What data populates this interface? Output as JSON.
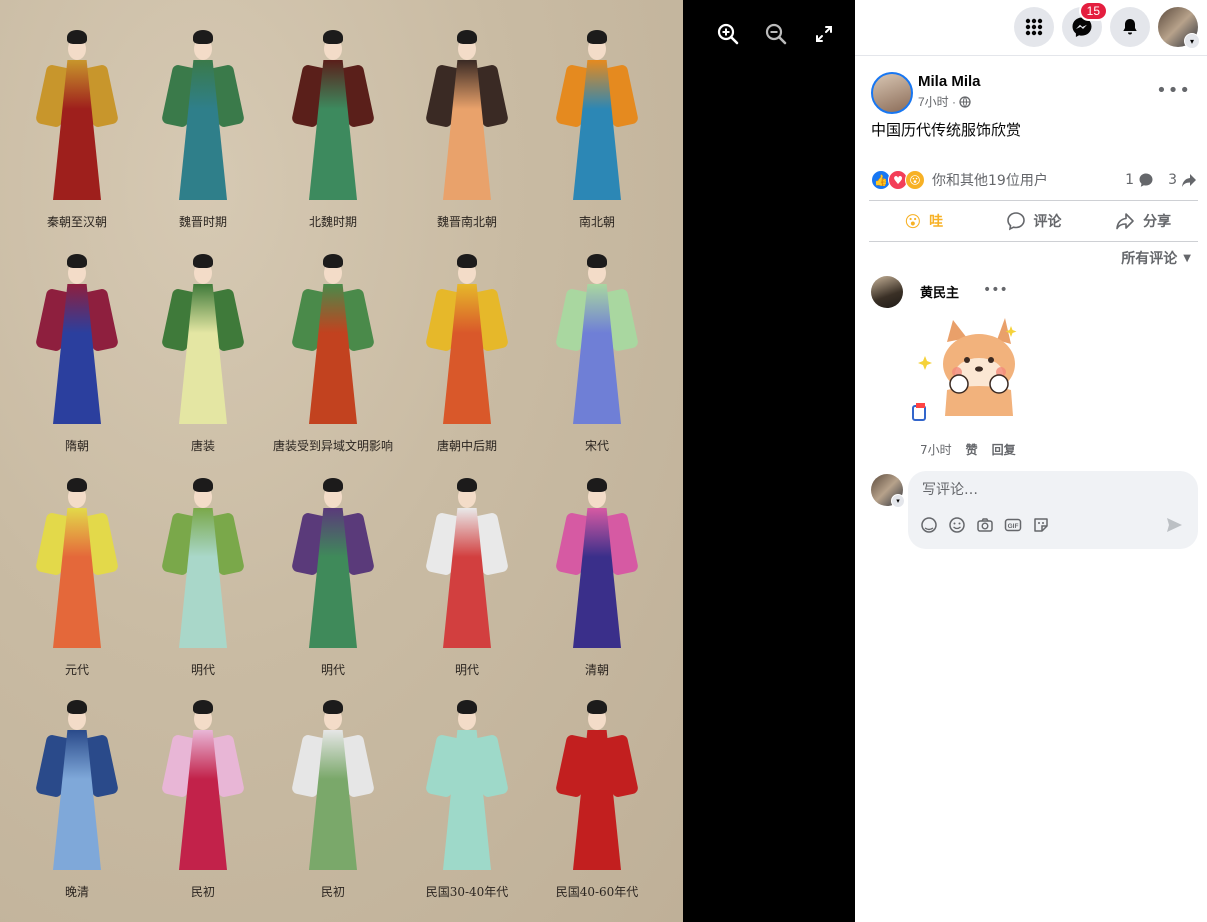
{
  "viewer": {
    "costumes": [
      {
        "label": "秦朝至汉朝",
        "colors": [
          "#9e1f1c",
          "#c8962c"
        ]
      },
      {
        "label": "魏晋时期",
        "colors": [
          "#2f7f8a",
          "#3a7a4a"
        ]
      },
      {
        "label": "北魏时期",
        "colors": [
          "#3d8a5e",
          "#5a1f1a"
        ]
      },
      {
        "label": "魏晋南北朝",
        "colors": [
          "#e9a26b",
          "#3a2a24"
        ]
      },
      {
        "label": "南北朝",
        "colors": [
          "#2c87b5",
          "#e58a1f"
        ]
      },
      {
        "label": "隋朝",
        "colors": [
          "#2b3f9e",
          "#8e1f3e"
        ]
      },
      {
        "label": "唐装",
        "colors": [
          "#e4e6a3",
          "#3f7a3a"
        ]
      },
      {
        "label": "唐装受到异域文明影响",
        "colors": [
          "#c2421f",
          "#4a8a4a"
        ]
      },
      {
        "label": "唐朝中后期",
        "colors": [
          "#d9582a",
          "#e6b82a"
        ]
      },
      {
        "label": "宋代",
        "colors": [
          "#6f7fd6",
          "#a9d7a0"
        ]
      },
      {
        "label": "元代",
        "colors": [
          "#e4683a",
          "#e3d94a"
        ]
      },
      {
        "label": "明代",
        "colors": [
          "#a9d7c9",
          "#7aa84a"
        ]
      },
      {
        "label": "明代",
        "colors": [
          "#3f8a5a",
          "#5a3a7a"
        ]
      },
      {
        "label": "明代",
        "colors": [
          "#d23f3f",
          "#e9e9e9"
        ]
      },
      {
        "label": "清朝",
        "colors": [
          "#3a2f8a",
          "#d65aa3"
        ]
      },
      {
        "label": "晚清",
        "colors": [
          "#7fa8d9",
          "#2a4a8a"
        ]
      },
      {
        "label": "民初",
        "colors": [
          "#c2224a",
          "#e8b6d6"
        ]
      },
      {
        "label": "民初",
        "colors": [
          "#7aa86a",
          "#e6e6e6"
        ]
      },
      {
        "label": "民国30-40年代",
        "colors": [
          "#9ed9c9",
          "#9ed9c9"
        ]
      },
      {
        "label": "民国40-60年代",
        "colors": [
          "#c21f1f",
          "#c21f1f"
        ]
      }
    ],
    "zoom_in_icon": "zoom-in-icon",
    "zoom_out_icon": "zoom-out-icon",
    "fullscreen_icon": "fullscreen-icon"
  },
  "topbar": {
    "messenger_badge": "15"
  },
  "post": {
    "author": "Mila Mila",
    "time": "7小时 ·",
    "text": "中国历代传统服饰欣赏",
    "reaction_summary": "你和其他19位用户",
    "comment_count": "1",
    "share_count": "3",
    "actions": {
      "react": "哇",
      "comment": "评论",
      "share": "分享"
    },
    "sort_label": "所有评论"
  },
  "comment": {
    "author": "黄民主",
    "time": "7小时",
    "like": "赞",
    "reply": "回复"
  },
  "composer": {
    "placeholder": "写评论…"
  },
  "colors": {
    "accent": "#1877f2",
    "wow_reaction": "#f7b125",
    "badge": "#e41e3f"
  }
}
